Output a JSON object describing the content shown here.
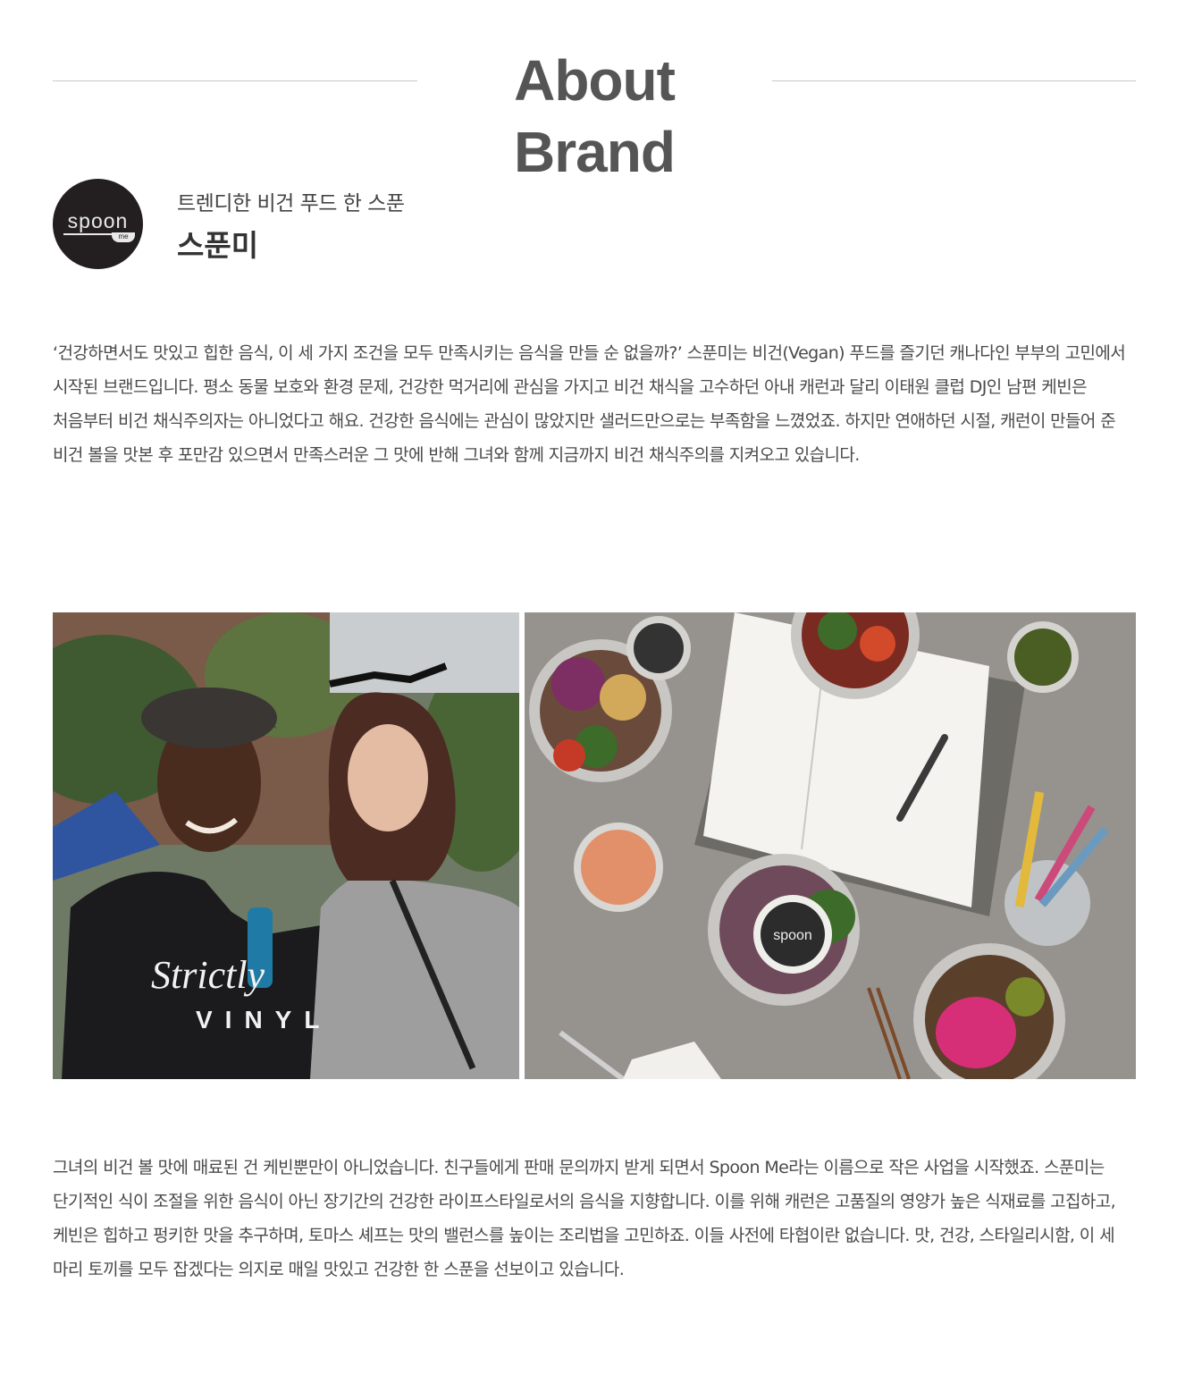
{
  "heading": {
    "title": "About Brand"
  },
  "brand": {
    "logo_text": "spoon",
    "logo_sub": "me",
    "tagline": "트렌디한 비건 푸드 한 스푼",
    "name": "스푼미"
  },
  "intro_paragraph": "‘건강하면서도 맛있고 힙한 음식, 이 세 가지 조건을 모두 만족시키는 음식을 만들 순 없을까?’ 스푼미는 비건(Vegan) 푸드를 즐기던 캐나다인 부부의 고민에서 시작된 브랜드입니다. 평소 동물 보호와 환경 문제, 건강한 먹거리에 관심을 가지고 비건 채식을 고수하던 아내 캐런과 달리 이태원 클럽 DJ인 남편 케빈은 처음부터 비건 채식주의자는 아니었다고 해요. 건강한 음식에는 관심이 많았지만 샐러드만으로는 부족함을 느꼈었죠. 하지만 연애하던 시절, 캐런이 만들어 준 비건 볼을 맛본 후 포만감 있으면서 만족스러운 그 맛에 반해 그녀와 함께 지금까지 비건 채식주의를 지켜오고 있습니다.",
  "photos": {
    "left_shirt_text_1": "Strictly",
    "left_shirt_text_2": "VINYL",
    "right_lid_text": "spoon"
  },
  "story_paragraph": "그녀의 비건 볼 맛에 매료된 건 케빈뿐만이 아니었습니다. 친구들에게 판매 문의까지 받게 되면서 Spoon Me라는 이름으로 작은 사업을 시작했죠. 스푼미는 단기적인 식이 조절을 위한 음식이 아닌 장기간의 건강한 라이프스타일로서의 음식을 지향합니다. 이를 위해 캐런은 고품질의 영양가 높은 식재료를 고집하고, 케빈은 힙하고 펑키한 맛을 추구하며, 토마스 셰프는 맛의 밸런스를 높이는 조리법을 고민하죠. 이들 사전에 타협이란 없습니다. 맛, 건강, 스타일리시함, 이 세 마리 토끼를 모두 잡겠다는 의지로 매일 맛있고 건강한 한 스푼을 선보이고 있습니다."
}
